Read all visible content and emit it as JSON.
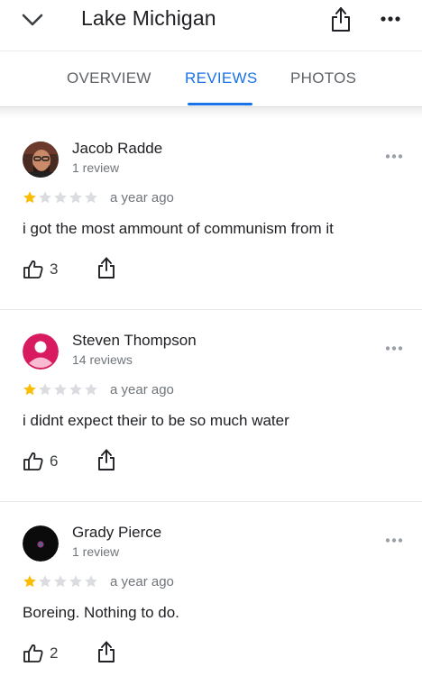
{
  "header": {
    "title": "Lake Michigan",
    "back_icon": "chevron-down-icon",
    "share_icon": "share-icon",
    "more_icon": "more-horiz-icon"
  },
  "tabs": [
    {
      "label": "OVERVIEW",
      "active": false
    },
    {
      "label": "REVIEWS",
      "active": true
    },
    {
      "label": "PHOTOS",
      "active": false
    }
  ],
  "colors": {
    "accent": "#1a73e8",
    "star_filled": "#fbbc04",
    "star_empty": "#dadce0"
  },
  "reviews": [
    {
      "name": "Jacob Radde",
      "count": "1 review",
      "rating": 1,
      "date": "a year ago",
      "text": "i got the most ammount of communism from it",
      "likes": "3",
      "avatar": "photo"
    },
    {
      "name": "Steven Thompson",
      "count": "14 reviews",
      "rating": 1,
      "date": "a year ago",
      "text": "i didnt expect their to be so much water",
      "likes": "6",
      "avatar": "default-person",
      "avatar_color": "#d81b60"
    },
    {
      "name": "Grady Pierce",
      "count": "1 review",
      "rating": 1,
      "date": "a year ago",
      "text": "Boreing. Nothing to do.",
      "likes": "2",
      "avatar": "dark-photo"
    }
  ]
}
